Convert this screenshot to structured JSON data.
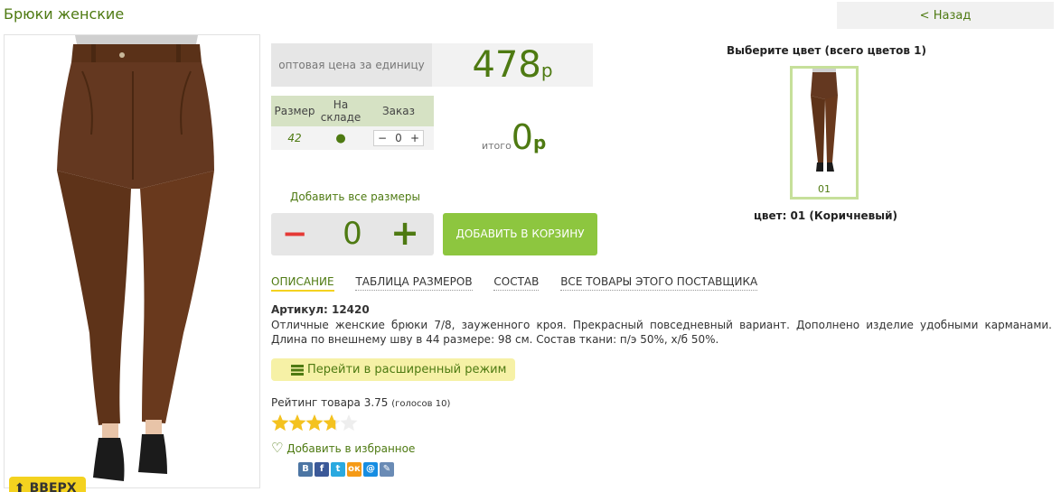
{
  "page": {
    "title": "Брюки женские",
    "back_label": "< Назад",
    "up_label": "ВВЕРХ"
  },
  "price": {
    "label": "оптовая цена за единицу",
    "value": "478",
    "currency": "р"
  },
  "sizes_table": {
    "headers": [
      "Размер",
      "На складе",
      "Заказ"
    ],
    "rows": [
      {
        "size": "42",
        "in_stock": "●",
        "order_minus": "−",
        "order_qty": "0",
        "order_plus": "+"
      }
    ]
  },
  "total": {
    "label": "итого",
    "value": "0",
    "currency": "р"
  },
  "add_all_label": "Добавить все размеры",
  "stepper": {
    "minus": "−",
    "value": "0",
    "plus": "+"
  },
  "add_to_cart_label": "ДОБАВИТЬ В КОРЗИНУ",
  "tabs": [
    "ОПИСАНИЕ",
    "ТАБЛИЦА РАЗМЕРОВ",
    "СОСТАВ",
    "ВСЕ ТОВАРЫ ЭТОГО ПОСТАВЩИКА"
  ],
  "article": "Артикул: 12420",
  "description": "Отличные женские брюки 7/8, зауженного кроя. Прекрасный повседневный вариант. Дополнено изделие удобными карманами. Длина по внешнему шву в 44 размере: 98 см.  Состав ткани: п/э 50%, х/б 50%.",
  "extended_mode_label": "Перейти в расширенный режим",
  "rating": {
    "label": "Рейтинг товара 3.75",
    "votes": "(голосов 10)",
    "value": 3.75,
    "max": 5
  },
  "favorite_label": "Добавить в избранное",
  "colors": {
    "title": "Выберите цвет (всего цветов 1)",
    "thumb_label": "01",
    "selected": "цвет: 01 (Коричневый)"
  },
  "social_icons": [
    "vk-icon",
    "facebook-icon",
    "twitter-icon",
    "odnoklassniki-icon",
    "mailru-icon",
    "livejournal-icon"
  ],
  "colors_palette": {
    "accent_green": "#4e7a12",
    "button_green": "#8dc63f",
    "yellow": "#f4d21f",
    "minus_red": "#e53935"
  }
}
